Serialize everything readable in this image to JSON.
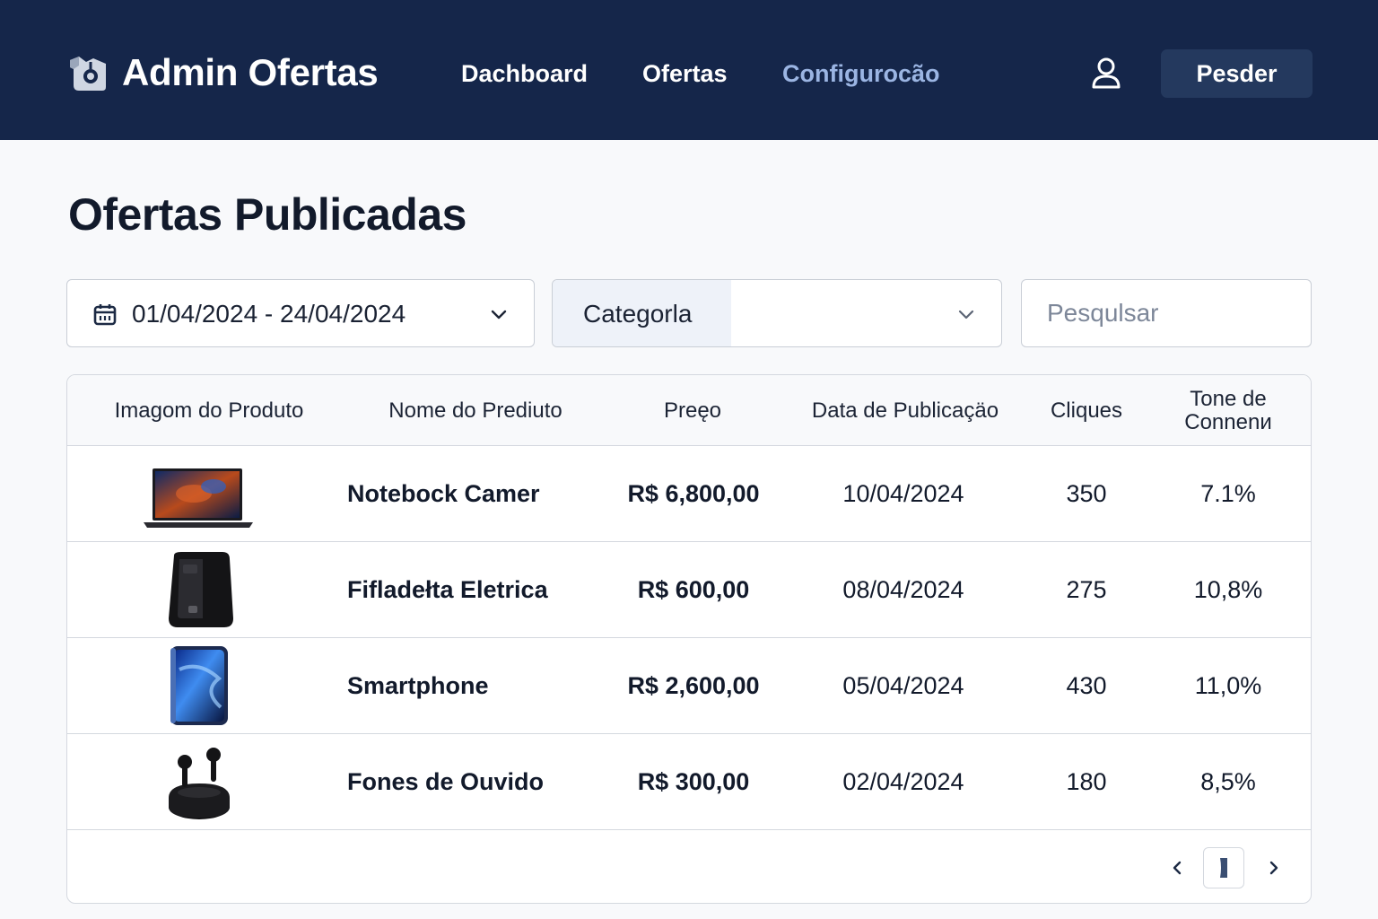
{
  "header": {
    "app_title": "Admin Ofertas",
    "nav": [
      {
        "label": "Dachboard"
      },
      {
        "label": "Ofertas"
      },
      {
        "label": "Configurocão"
      }
    ],
    "button_label": "Pesder",
    "user_icon": "user-icon",
    "logo_icon": "app-logo-icon"
  },
  "page": {
    "title": "Ofertas Publicadas"
  },
  "filters": {
    "date_range": "01/04/2024 - 24/04/2024",
    "date_icon": "calendar-icon",
    "category_label": "Categorla",
    "search_placeholder": "Pesqulsar"
  },
  "table": {
    "columns": [
      "Imagom do Produto",
      "Nome do Prediuto",
      "Preęo",
      "Data de Publicaçäo",
      "Cliques",
      "Tone de Connenи"
    ],
    "rows": [
      {
        "image": "laptop-image",
        "name": "Notebock Camer",
        "price": "R$ 6,800,00",
        "date": "10/04/2024",
        "clicks": "350",
        "rate": "7.1%"
      },
      {
        "image": "air-fryer-image",
        "name": "Fifladełta Eletrica",
        "price": "R$ 600,00",
        "date": "08/04/2024",
        "clicks": "275",
        "rate": "10,8%"
      },
      {
        "image": "smartphone-image",
        "name": "Smartphone",
        "price": "R$ 2,600,00",
        "date": "05/04/2024",
        "clicks": "430",
        "rate": "11,0%"
      },
      {
        "image": "earbuds-image",
        "name": "Fones de Ouvido",
        "price": "R$ 300,00",
        "date": "02/04/2024",
        "clicks": "180",
        "rate": "8,5%"
      }
    ]
  },
  "pagination": {
    "prev_icon": "chevron-left-icon",
    "next_icon": "chevron-right-icon"
  },
  "colors": {
    "header_bg": "#15264a",
    "header_button_bg": "#24395e",
    "nav_active": "#9bb5e3",
    "page_bg": "#f8f9fb"
  }
}
